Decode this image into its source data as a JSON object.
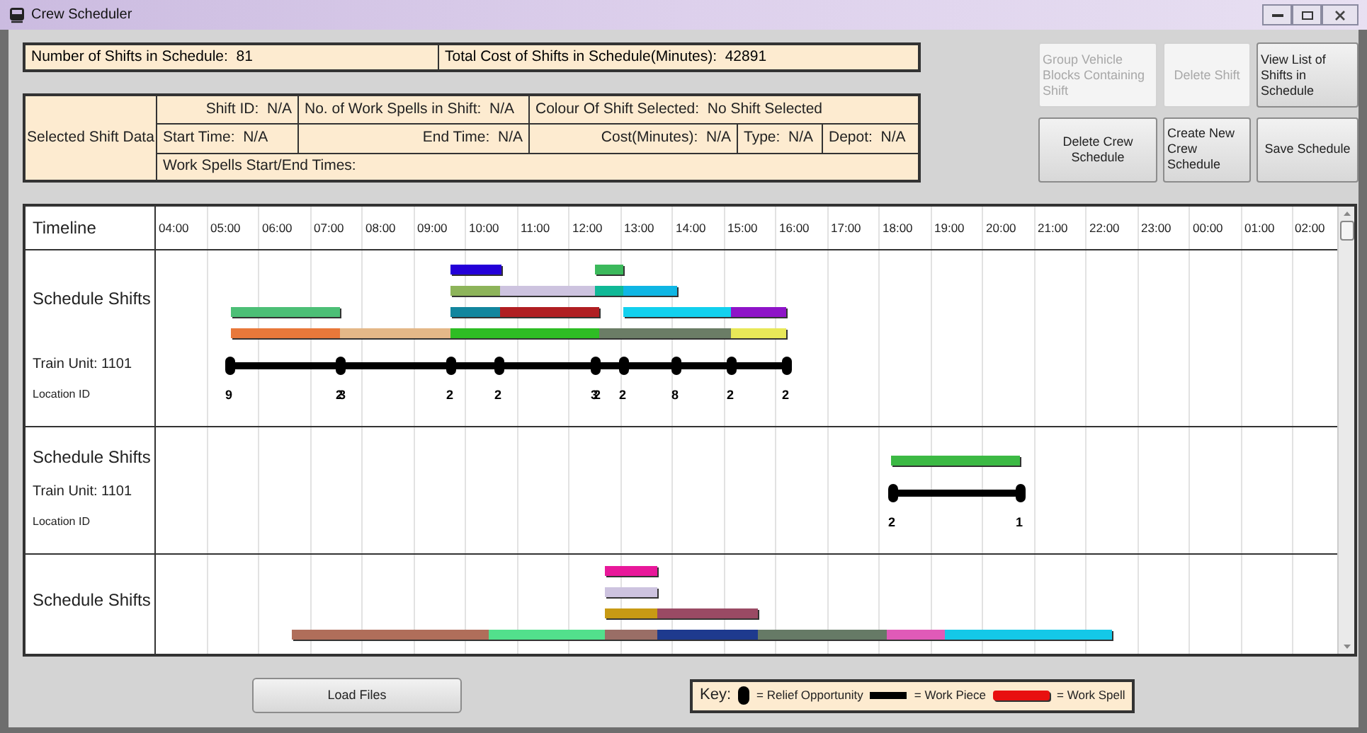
{
  "window": {
    "title": "Crew Scheduler"
  },
  "summary": [
    "Number of Shifts in Schedule:  81",
    "Total Cost of Shifts in Schedule(Minutes):  42891"
  ],
  "selected_shift": {
    "label": "Selected Shift Data",
    "row_1": [
      "Shift ID:  N/A",
      "No. of Work Spells in Shift:  N/A",
      "Colour Of Shift Selected:  No Shift Selected"
    ],
    "row_2": [
      "Start Time:  N/A",
      "End Time:  N/A",
      "Cost(Minutes):  N/A",
      "Type:  N/A",
      "Depot:  N/A"
    ],
    "row_3": "Work Spells Start/End Times:"
  },
  "buttons": [
    {
      "label": "Group Vehicle Blocks Containing Shift",
      "disabled": true
    },
    {
      "label": "Delete Shift",
      "disabled": true
    },
    {
      "label": "View List of Shifts in Schedule",
      "disabled": false
    },
    {
      "label": "Delete Crew Schedule",
      "disabled": false
    },
    {
      "label": "Create New Crew Schedule",
      "disabled": false
    },
    {
      "label": "Save Schedule",
      "disabled": false
    }
  ],
  "timeline": {
    "label": "Timeline",
    "hours": [
      "04:00",
      "05:00",
      "06:00",
      "07:00",
      "08:00",
      "09:00",
      "10:00",
      "11:00",
      "12:00",
      "13:00",
      "14:00",
      "15:00",
      "16:00",
      "17:00",
      "18:00",
      "19:00",
      "20:00",
      "21:00",
      "22:00",
      "23:00",
      "00:00",
      "01:00",
      "02:00"
    ]
  },
  "sections": [
    {
      "label": "Schedule Shifts",
      "lanes": [
        [
          {
            "color": "#2400d8"
          },
          {
            "color": "#3cb95c"
          }
        ],
        [
          {
            "color": "#8db45a"
          },
          {
            "color": "#cdc3df"
          },
          {
            "color": "#10b896"
          },
          {
            "color": "#0fb6e4"
          }
        ],
        [
          {
            "color": "#4cbf76"
          },
          {
            "color": "#12869e"
          },
          {
            "color": "#b01e22"
          },
          {
            "color": "#12d0ee"
          },
          {
            "color": "#8e14c8"
          }
        ],
        [
          {
            "color": "#e8783a"
          },
          {
            "color": "#e4b888"
          },
          {
            "color": "#2ebd24"
          },
          {
            "color": "#6b7d66"
          },
          {
            "color": "#e8e858"
          }
        ]
      ],
      "train": {
        "label": "Train Unit: 1101",
        "location_label": "Location ID",
        "stops": [
          "9",
          "23",
          "2",
          "2",
          "32",
          "2",
          "8",
          "2",
          "2"
        ]
      }
    },
    {
      "label": "Schedule Shifts",
      "lanes": [
        [
          {
            "color": "#3cb944"
          }
        ]
      ],
      "train": {
        "label": "Train Unit: 1101",
        "location_label": "Location ID",
        "stops": [
          "2",
          "1"
        ]
      }
    },
    {
      "label": "Schedule Shifts",
      "lanes": [
        [
          {
            "color": "#e8189a"
          }
        ],
        [
          {
            "color": "#cdc3df"
          }
        ],
        [
          {
            "color": "#c89a14"
          },
          {
            "color": "#9a4a64"
          }
        ],
        [
          {
            "color": "#b06e5a"
          },
          {
            "color": "#52e08c"
          },
          {
            "color": "#9a6e66"
          },
          {
            "color": "#1e3a8e"
          },
          {
            "color": "#667a66"
          },
          {
            "color": "#e05ab8"
          },
          {
            "color": "#14c8e8"
          }
        ]
      ]
    }
  ],
  "load_button": "Load Files",
  "key": {
    "label": "Key:",
    "items": [
      {
        "kind": "relief",
        "text": "= Relief Opportunity"
      },
      {
        "kind": "piece",
        "text": "= Work Piece"
      },
      {
        "kind": "spell",
        "text": "= Work Spell"
      }
    ]
  }
}
